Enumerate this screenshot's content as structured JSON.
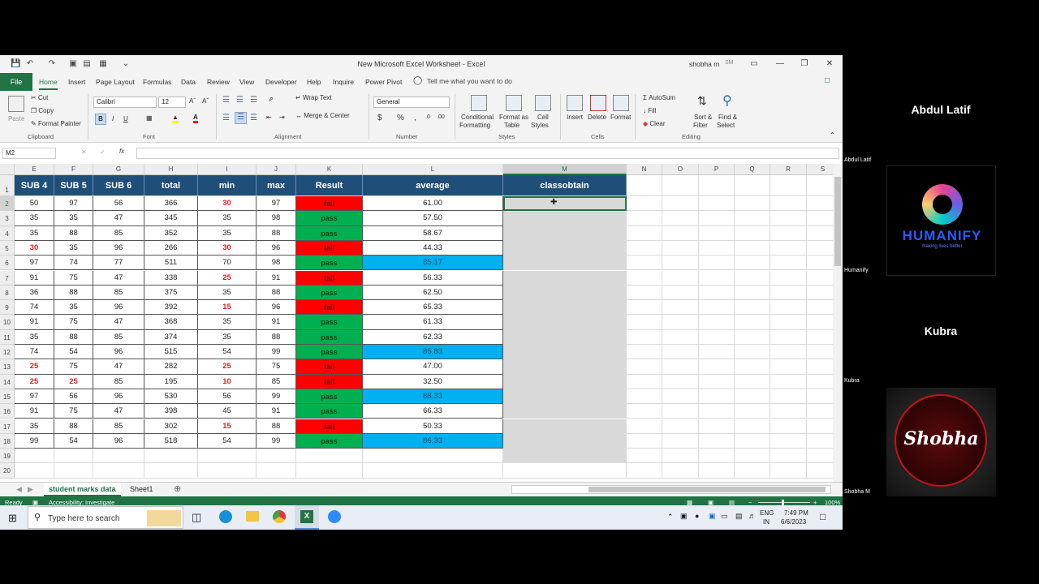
{
  "window": {
    "title": "New Microsoft Excel Worksheet  -  Excel",
    "user_name": "shobha m",
    "user_initials": "SM"
  },
  "tabs": [
    "Home",
    "Insert",
    "Page Layout",
    "Formulas",
    "Data",
    "Review",
    "View",
    "Developer",
    "Help",
    "Inquire",
    "Power Pivot"
  ],
  "file_tab": "File",
  "tell_me": "Tell me what you want to do",
  "ribbon": {
    "clipboard": {
      "paste": "Paste",
      "cut": "Cut",
      "copy": "Copy",
      "format_painter": "Format Painter",
      "label": "Clipboard"
    },
    "font": {
      "name": "Calibri",
      "size": "12",
      "label": "Font",
      "bold": "B",
      "italic": "I",
      "underline": "U"
    },
    "alignment": {
      "wrap": "Wrap Text",
      "merge": "Merge & Center",
      "label": "Alignment"
    },
    "number": {
      "format": "General",
      "label": "Number",
      "currency": "$",
      "percent": "%",
      "comma": ","
    },
    "styles": {
      "conditional": "Conditional",
      "conditional2": "Formatting",
      "format_as": "Format as",
      "format_as2": "Table",
      "cell": "Cell",
      "cell2": "Styles",
      "label": "Styles"
    },
    "cells": {
      "insert": "Insert",
      "delete": "Delete",
      "format": "Format",
      "label": "Cells"
    },
    "editing": {
      "autosum": "AutoSum",
      "fill": "Fill",
      "clear": "Clear",
      "sort": "Sort &",
      "sort2": "Filter",
      "find": "Find &",
      "find2": "Select",
      "label": "Editing"
    }
  },
  "formula_bar": {
    "name_box": "M2",
    "fx": "fx",
    "value": ""
  },
  "columns": [
    "E",
    "F",
    "G",
    "H",
    "I",
    "J",
    "K",
    "L",
    "M",
    "N",
    "O",
    "P",
    "Q",
    "R",
    "S"
  ],
  "row_numbers": [
    "1",
    "2",
    "3",
    "4",
    "5",
    "6",
    "7",
    "8",
    "9",
    "10",
    "11",
    "12",
    "13",
    "14",
    "15",
    "16",
    "17",
    "18",
    "19",
    "20"
  ],
  "headers": [
    "SUB 4",
    "SUB 5",
    "SUB 6",
    "total",
    "min",
    "max",
    "Result",
    "average",
    "classobtain"
  ],
  "rows": [
    {
      "sub4": "50",
      "sub5": "97",
      "sub6": "56",
      "total": "366",
      "min": "30",
      "max": "97",
      "result": "fail",
      "average": "61.00"
    },
    {
      "sub4": "35",
      "sub5": "35",
      "sub6": "47",
      "total": "345",
      "min": "35",
      "max": "98",
      "result": "pass",
      "average": "57.50"
    },
    {
      "sub4": "35",
      "sub5": "88",
      "sub6": "85",
      "total": "352",
      "min": "35",
      "max": "88",
      "result": "pass",
      "average": "58.67"
    },
    {
      "sub4": "30",
      "sub5": "35",
      "sub6": "96",
      "total": "266",
      "min": "30",
      "max": "96",
      "result": "fail",
      "average": "44.33"
    },
    {
      "sub4": "97",
      "sub5": "74",
      "sub6": "77",
      "total": "511",
      "min": "70",
      "max": "98",
      "result": "pass",
      "average": "85.17"
    },
    {
      "sub4": "91",
      "sub5": "75",
      "sub6": "47",
      "total": "338",
      "min": "25",
      "max": "91",
      "result": "fail",
      "average": "56.33"
    },
    {
      "sub4": "36",
      "sub5": "88",
      "sub6": "85",
      "total": "375",
      "min": "35",
      "max": "88",
      "result": "pass",
      "average": "62.50"
    },
    {
      "sub4": "74",
      "sub5": "35",
      "sub6": "96",
      "total": "392",
      "min": "15",
      "max": "96",
      "result": "fail",
      "average": "65.33"
    },
    {
      "sub4": "91",
      "sub5": "75",
      "sub6": "47",
      "total": "368",
      "min": "35",
      "max": "91",
      "result": "pass",
      "average": "61.33"
    },
    {
      "sub4": "35",
      "sub5": "88",
      "sub6": "85",
      "total": "374",
      "min": "35",
      "max": "88",
      "result": "pass",
      "average": "62.33"
    },
    {
      "sub4": "74",
      "sub5": "54",
      "sub6": "96",
      "total": "515",
      "min": "54",
      "max": "99",
      "result": "pass",
      "average": "85.83"
    },
    {
      "sub4": "25",
      "sub5": "75",
      "sub6": "47",
      "total": "282",
      "min": "25",
      "max": "75",
      "result": "fail",
      "average": "47.00"
    },
    {
      "sub4": "25",
      "sub5": "25",
      "sub6": "85",
      "total": "195",
      "min": "10",
      "max": "85",
      "result": "fail",
      "average": "32.50"
    },
    {
      "sub4": "97",
      "sub5": "56",
      "sub6": "96",
      "total": "530",
      "min": "56",
      "max": "99",
      "result": "pass",
      "average": "88.33"
    },
    {
      "sub4": "91",
      "sub5": "75",
      "sub6": "47",
      "total": "398",
      "min": "45",
      "max": "91",
      "result": "pass",
      "average": "66.33"
    },
    {
      "sub4": "35",
      "sub5": "88",
      "sub6": "85",
      "total": "302",
      "min": "15",
      "max": "88",
      "result": "fail",
      "average": "50.33"
    },
    {
      "sub4": "99",
      "sub5": "54",
      "sub6": "96",
      "total": "518",
      "min": "54",
      "max": "99",
      "result": "pass",
      "average": "86.33"
    }
  ],
  "sheets": {
    "active": "student marks data",
    "other": "Sheet1"
  },
  "status": {
    "ready": "Ready",
    "accessibility": "Accessibility: Investigate",
    "zoom": "100%"
  },
  "taskbar": {
    "search_placeholder": "Type here to search",
    "lang": "ENG",
    "region": "IN",
    "time": "7:49 PM",
    "date": "6/6/2023"
  },
  "participants": [
    {
      "name": "Abdul Latif",
      "label": "Abdul Latif"
    },
    {
      "name": "",
      "label": "Humanify",
      "logo_text": "HUMANIFY",
      "logo_sub": "making lives better"
    },
    {
      "name": "Kubra",
      "label": "Kubra"
    },
    {
      "name": "",
      "label": "Shobha M",
      "logo_text": "Shobha"
    }
  ],
  "colors": {
    "excel_green": "#217346",
    "header_blue": "#1f4e79",
    "fail_red": "#ff0000",
    "pass_green": "#00b050",
    "avg_blue": "#00b0f0"
  }
}
